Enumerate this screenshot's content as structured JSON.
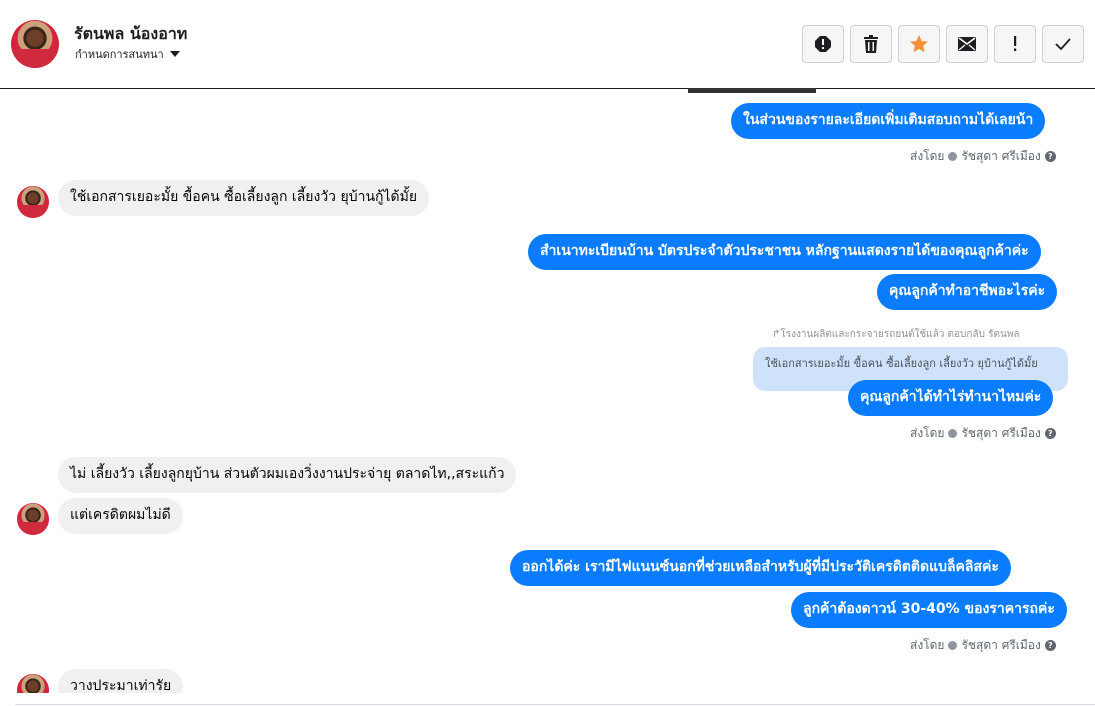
{
  "header": {
    "name": "รัตนพล น้องอาท",
    "subtitle": "กำหนดการสนทนา",
    "actions": [
      "spam-icon",
      "trash-icon",
      "star-icon",
      "envelope-icon",
      "exclamation-icon",
      "check-icon"
    ],
    "star_color": "#f7923b"
  },
  "messages": {
    "m1": "ในส่วนของรายละเอียดเพิ่มเติมสอบถามได้เลยน้า",
    "sent1": "ส่งโดย",
    "agent1": "รัชสุดา ศรีเมือง",
    "m2": "ใช้เอกสารเยอะมั้ย ขื้อคน ซื้อเลี้ยงลูก  เลี้ยงวัว  ยุบ้านกู้ได้มั้ย",
    "m3": "สำเนาทะเบียนบ้าน บัตรประจำตัวประชาชน หลักฐานแสดงรายได้ของคุณลูกค้าค่ะ",
    "m4": "คุณลูกค้าทำอาชีพอะไรค่ะ",
    "reply_note": "โรงงานผลิตและกระจายรถยนต์ใช้แล้ว ตอบกลับ รัตนพล",
    "quote": "ใช้เอกสารเยอะมั้ย ขื้อคน ซื้อเลี้ยงลูก เลี้ยงวัว ยุบ้านกู้ได้มั้ย",
    "m5": "คุณลูกค้าได้ทำไร่ทำนาไหมค่ะ",
    "sent2": "ส่งโดย",
    "agent2": "รัชสุดา ศรีเมือง",
    "m6": "ไม่ เลี้ยงวัว เลี้ยงลูกยุบ้าน   ส่วนตัวผมเองวิ่งงานประจ่ายุ  ตลาดไท,,สระแก้ว",
    "m7": "แต่เครดิตผมไม่ดี",
    "m8": "ออกได้ค่ะ เรามีไฟแนนซ์นอกที่ช่วยเหลือสำหรับผู้ที่มีประวัติเครดิตติดแบล็คลิสค่ะ",
    "m9": "ลูกค้าต้องดาวน์ 30-40% ของราคารถค่ะ",
    "sent3": "ส่งโดย",
    "agent3": "รัชสุดา ศรีเมือง",
    "m10": "วางประมาเท่ารัย"
  },
  "colors": {
    "outgoing": "#0a7cff",
    "incoming": "#f0f0f0",
    "quote": "#cfe2fb"
  }
}
